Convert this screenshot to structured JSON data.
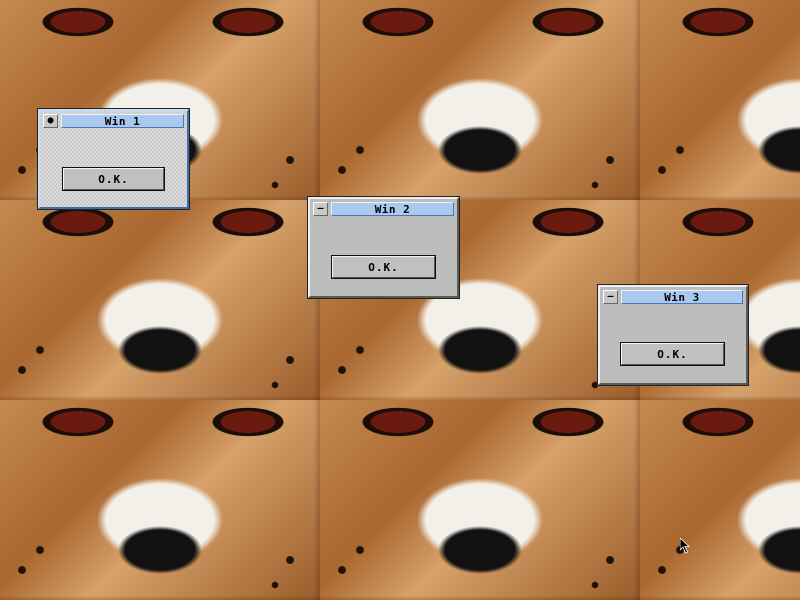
{
  "windows": [
    {
      "title": "Win 1",
      "close_symbol": "●",
      "button_label": "O.K.",
      "active": true
    },
    {
      "title": "Win 2",
      "close_symbol": "—",
      "button_label": "O.K.",
      "active": false
    },
    {
      "title": "Win 3",
      "close_symbol": "—",
      "button_label": "O.K.",
      "active": false
    }
  ],
  "cursor": {
    "icon": "arrow-pointer-icon"
  },
  "colors": {
    "titlebar_bg": "#a9c9ef",
    "window_bg": "#bdbdbd",
    "active_frame": "#3c6ea8"
  }
}
